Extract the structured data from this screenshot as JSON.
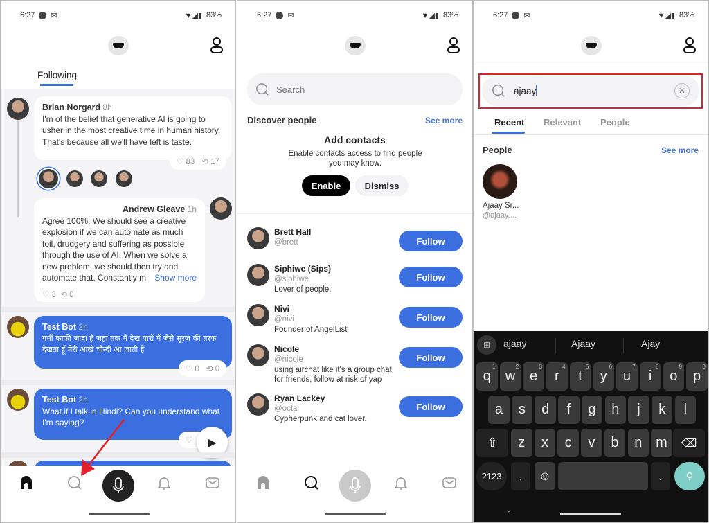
{
  "status": {
    "time": "6:27",
    "battery": "83%"
  },
  "colors": {
    "accent": "#3b6fe0",
    "highlight": "#d9262e",
    "keyboard_action": "#7fcfc8"
  },
  "feed": {
    "tab": "Following",
    "posts": [
      {
        "author": "Brian Norgard",
        "time": "8h",
        "text": "I'm of the belief that generative AI is going to usher in the most creative time in human history. That's because all we'll have left is taste.",
        "likes": "83",
        "reposts": "17"
      },
      {
        "author": "Andrew Gleave",
        "time": "1h",
        "text": "Agree 100%. We should see a creative explosion if we can automate as much toil, drudgery and suffering as possible through the use of AI. When we solve a new problem, we should then try and automate that. Constantly m",
        "show_more": "Show more",
        "likes": "3",
        "reposts": "0"
      },
      {
        "author": "Test Bot",
        "time": "2h",
        "text": "गर्मी काफी जादा है जहां तक मैं देख पारों मैं जैसे सूरज की तरफ देखता हूँ मेरी आखे चौन्दी आ जाती है",
        "likes": "0",
        "reposts": "0"
      },
      {
        "author": "Test Bot",
        "time": "2h",
        "text": "What if I talk in Hindi? Can you understand what I'm saying?"
      }
    ]
  },
  "discover": {
    "search_placeholder": "Search",
    "title": "Discover people",
    "see_more": "See more",
    "contacts_title": "Add contacts",
    "contacts_desc": "Enable contacts access to find people you may know.",
    "enable": "Enable",
    "dismiss": "Dismiss",
    "follow": "Follow",
    "people": [
      {
        "name": "Brett Hall",
        "handle": "@brett",
        "bio": ""
      },
      {
        "name": "Siphiwe (Sips)",
        "handle": "@siphiwe",
        "bio": "Lover of people."
      },
      {
        "name": "Nivi",
        "handle": "@nivi",
        "bio": "Founder of AngelList"
      },
      {
        "name": "Nicole",
        "handle": "@nicole",
        "bio": "using airchat like it's a group chat for friends, follow at risk of yap"
      },
      {
        "name": "Ryan Lackey",
        "handle": "@octal",
        "bio": "Cypherpunk and cat lover."
      }
    ]
  },
  "results": {
    "query": "ajaay",
    "tabs": [
      "Recent",
      "Relevant",
      "People"
    ],
    "section": "People",
    "see_more": "See more",
    "person": {
      "name": "Ajaay Sr...",
      "handle": "@ajaay...."
    }
  },
  "keyboard": {
    "suggestions": [
      "ajaay",
      "Ajaay",
      "Ajay"
    ],
    "row1": [
      "q",
      "w",
      "e",
      "r",
      "t",
      "y",
      "u",
      "i",
      "o",
      "p"
    ],
    "row1_nums": [
      "1",
      "2",
      "3",
      "4",
      "5",
      "6",
      "7",
      "8",
      "9",
      "0"
    ],
    "row2": [
      "a",
      "s",
      "d",
      "f",
      "g",
      "h",
      "j",
      "k",
      "l"
    ],
    "row3": [
      "z",
      "x",
      "c",
      "v",
      "b",
      "n",
      "m"
    ],
    "symbols": "?123",
    "comma": ",",
    "period": "."
  }
}
